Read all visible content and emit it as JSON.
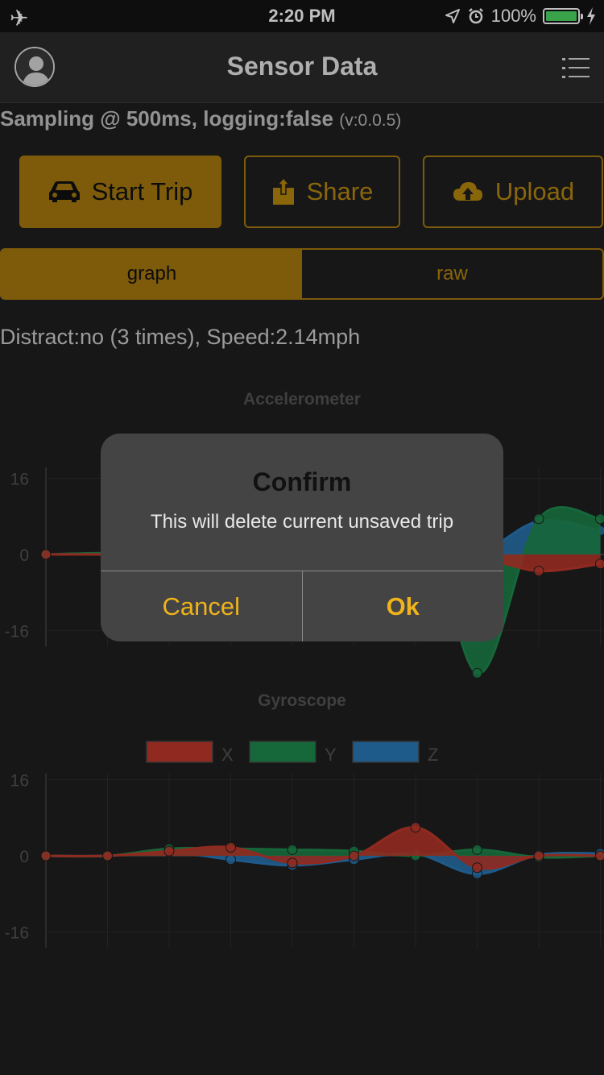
{
  "status_bar": {
    "time": "2:20 PM",
    "battery": "100%",
    "icons": [
      "airplane-mode-icon",
      "location-arrow-icon",
      "alarm-icon",
      "battery-icon",
      "charging-bolt-icon"
    ]
  },
  "nav": {
    "title": "Sensor Data",
    "avatar_icon": "user-avatar-icon",
    "menu_icon": "list-menu-icon"
  },
  "sampling": {
    "text": "Sampling @ 500ms, logging:false",
    "version": "(v:0.0.5)"
  },
  "actions": {
    "start_trip": "Start Trip",
    "share": "Share",
    "upload": "Upload"
  },
  "segments": {
    "graph": "graph",
    "raw": "raw",
    "selected": "graph"
  },
  "distract_text": "Distract:no (3 times), Speed:2.14mph",
  "colors": {
    "accent": "#a77a0f",
    "accent_text": "#b8880f",
    "dialog_button": "#f0b31a",
    "x": "#c0392b",
    "y": "#1e8a4c",
    "z": "#2a7ab8"
  },
  "chart_data": [
    {
      "type": "area",
      "title": "Accelerometer",
      "ylim": [
        -16,
        16
      ],
      "yticks": [
        "16",
        "0",
        "-16"
      ],
      "series": [
        {
          "key": "x",
          "values": [
            0,
            0,
            0,
            0,
            0,
            0,
            -5,
            -1,
            -3.5,
            -2
          ]
        },
        {
          "key": "y",
          "values": [
            0,
            0.3,
            0,
            0,
            0,
            0,
            16,
            -25,
            7.5,
            7.5
          ]
        },
        {
          "key": "z",
          "values": [
            0,
            0,
            0,
            0,
            0,
            0,
            0,
            0,
            7,
            5
          ]
        }
      ]
    },
    {
      "type": "area",
      "title": "Gyroscope",
      "ylim": [
        -16,
        16
      ],
      "yticks": [
        "16",
        "0",
        "-16"
      ],
      "legend": [
        "X",
        "Y",
        "Z"
      ],
      "series": [
        {
          "key": "x",
          "values": [
            0,
            0,
            1,
            1.8,
            -1.5,
            0,
            6,
            -2.5,
            0,
            0
          ]
        },
        {
          "key": "y",
          "values": [
            0,
            0,
            1.5,
            1.5,
            1.3,
            1,
            0,
            1.3,
            -0.3,
            0
          ]
        },
        {
          "key": "z",
          "values": [
            0,
            0,
            0.8,
            -0.8,
            -2,
            -0.8,
            0.4,
            -3.8,
            0.2,
            0.5
          ]
        }
      ]
    }
  ],
  "dialog": {
    "title": "Confirm",
    "message": "This will delete current unsaved trip",
    "cancel": "Cancel",
    "ok": "Ok"
  }
}
